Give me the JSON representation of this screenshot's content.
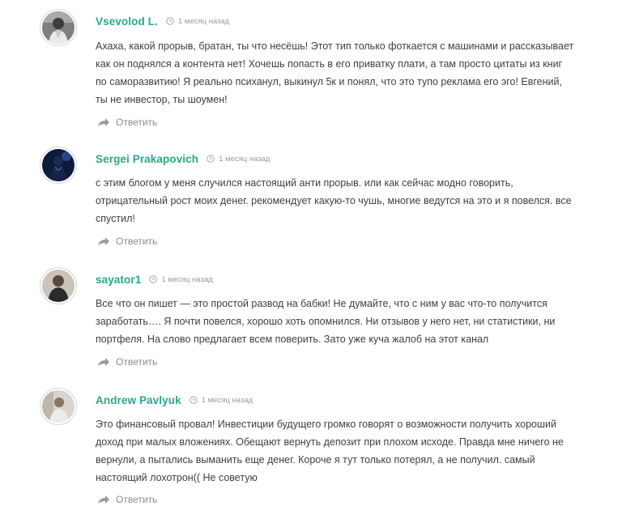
{
  "comments": [
    {
      "author": "Vsevolod L.",
      "date": "1 месяц назад",
      "lines": [
        "Ахаха, какой прорыв, братан, ты что несёшь! Этот тип только фоткается с машинами и рассказывает",
        "как он поднялся а контента нет! Хочешь попасть в его приватку плати, а там просто цитаты из книг",
        "по саморазвитию! Я реально психанул, выкинул 5к и понял, что это тупо реклама его эго! Евгений,",
        "ты не инвестор, ты шоумен!"
      ],
      "reply_label": "Ответить",
      "avatar_icon": "avatar-photo-icon"
    },
    {
      "author": "Sergei Prakapovich",
      "date": "1 месяц назад",
      "lines": [
        "с этим блогом у меня случился настоящий анти прорыв. или как сейчас модно говорить,",
        "отрицательный рост моих денег. рекомендует какую-то чушь, многие ведутся на это и я повелся. все",
        "спустил!"
      ],
      "reply_label": "Ответить",
      "avatar_icon": "avatar-photo-icon"
    },
    {
      "author": "sayator1",
      "date": "1 месяц назад",
      "lines": [
        "Все что он пишет — это простой развод на бабки! Не думайте, что с ним у вас что-то получится",
        "заработать…. Я почти повелся, хорошо хоть опомнился. Ни отзывов у него нет, ни статистики, ни",
        "портфеля. На слово предлагает всем поверить. Зато уже куча жалоб на этот канал"
      ],
      "reply_label": "Ответить",
      "avatar_icon": "avatar-photo-icon"
    },
    {
      "author": "Andrew Pavlyuk",
      "date": "1 месяц назад",
      "lines": [
        "Это финансовый провал! Инвестиции будущего громко говорят о возможности получить хороший",
        "доход при малых вложениях. Обещают вернуть депозит при плохом исходе. Правда мне ничего не",
        "вернули, а пытались выманить еще денег. Короче я тут только потерял, а не получил. самый",
        "настоящий лохотрон(( Не советую"
      ],
      "reply_label": "Ответить",
      "avatar_icon": "avatar-photo-icon"
    }
  ],
  "colors": {
    "author": "#27a889",
    "text": "#3f3f3f",
    "meta": "#9a9a9a",
    "reply": "#8b8b8b"
  },
  "icons": {
    "date": "clock-icon",
    "reply": "reply-arrow-icon"
  }
}
